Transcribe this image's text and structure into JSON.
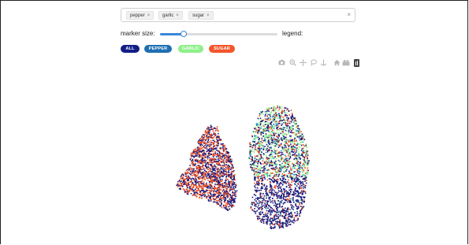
{
  "search": {
    "tags": [
      {
        "label": "pepper"
      },
      {
        "label": "garlic"
      },
      {
        "label": "sugar"
      }
    ],
    "remove_glyph": "×",
    "clear_glyph": "×"
  },
  "controls": {
    "marker_size_label": "marker size:",
    "marker_size_value": 0.2,
    "legend_label": "legend:"
  },
  "filters": [
    {
      "label": "ALL",
      "color": "#121d86"
    },
    {
      "label": "PEPPER",
      "color": "#1f6fb2"
    },
    {
      "label": "GARLIC",
      "color": "#8ef08a"
    },
    {
      "label": "SUGAR",
      "color": "#f2562a"
    }
  ],
  "toolbar": {
    "icons": [
      "camera-icon",
      "zoom-icon",
      "pan-icon",
      "lasso-icon",
      "anchor-icon",
      "home-icon",
      "reset-icon",
      "plotly-logo-icon"
    ]
  },
  "colors": {
    "navy": "#1b1a7a",
    "orange": "#f04a1a",
    "green": "#8ef08a",
    "teal": "#1aa3b8"
  }
}
